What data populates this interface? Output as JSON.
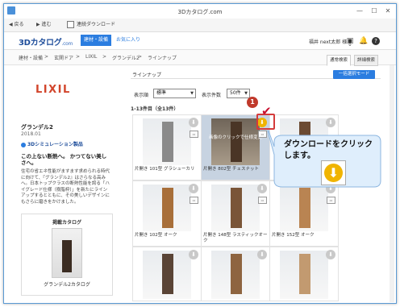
{
  "window": {
    "title": "3Dカタログ.com",
    "controls": [
      "—",
      "☐",
      "✕"
    ]
  },
  "toolbar": {
    "back": "戻る",
    "forward": "進む",
    "continuous_download": "連続ダウンロード"
  },
  "site": {
    "logo": "3Dカタログ",
    "logo_suffix": ".com",
    "tabs": [
      "建材・設備",
      "お気に入り"
    ],
    "user": "福井 next太郎 様",
    "badge_count": "0"
  },
  "breadcrumb": [
    "建材・設備",
    "玄関ドア",
    "LIXIL",
    "グランデル2",
    "ラインナップ"
  ],
  "view_tabs": [
    "通常検索",
    "詳細検索"
  ],
  "product": {
    "maker": "LIXIL",
    "name": "グランデル2",
    "date": "2018.01",
    "sim_label": "3Dシミュレーション製品",
    "catch": "この上ない断熱へ。 かつてない美しさへ。",
    "description": "住宅の省エネ性能がますます求められる時代に向けて、『グランデル2』はさらなる高みへ。日本トップクラスの断熱性能を誇る「ハイグレード仕様（樹脂枠）」を新たにラインアップするとともに、その美しいデザインにもさらに磨きをかけました。",
    "catalog_title": "掲載カタログ",
    "catalog_label": "グランデル2カタログ"
  },
  "lineup": {
    "title": "ラインナップ",
    "mode_button": "一括選択モード",
    "sort_label": "表示順",
    "sort_value": "標準",
    "count_label": "表示件数",
    "count_value": "50件",
    "result": "1-13件目（全13件）",
    "hover_text": "画像のクリックで仕様変更",
    "items": [
      "片開き 101型 グラシューカリ",
      "片開き 802型 チェスナット",
      "",
      "片開き 102型 オーク",
      "片開き 148型 ラスティックオーク",
      "片開き 152型 オーク",
      "",
      "",
      ""
    ]
  },
  "annotation": {
    "step": "1",
    "text": "ダウンロードをクリックします。"
  },
  "colors": {
    "accent": "#2b7de0",
    "download": "#f0b400",
    "marker": "#c0392b",
    "callout": "#dfeefc"
  }
}
